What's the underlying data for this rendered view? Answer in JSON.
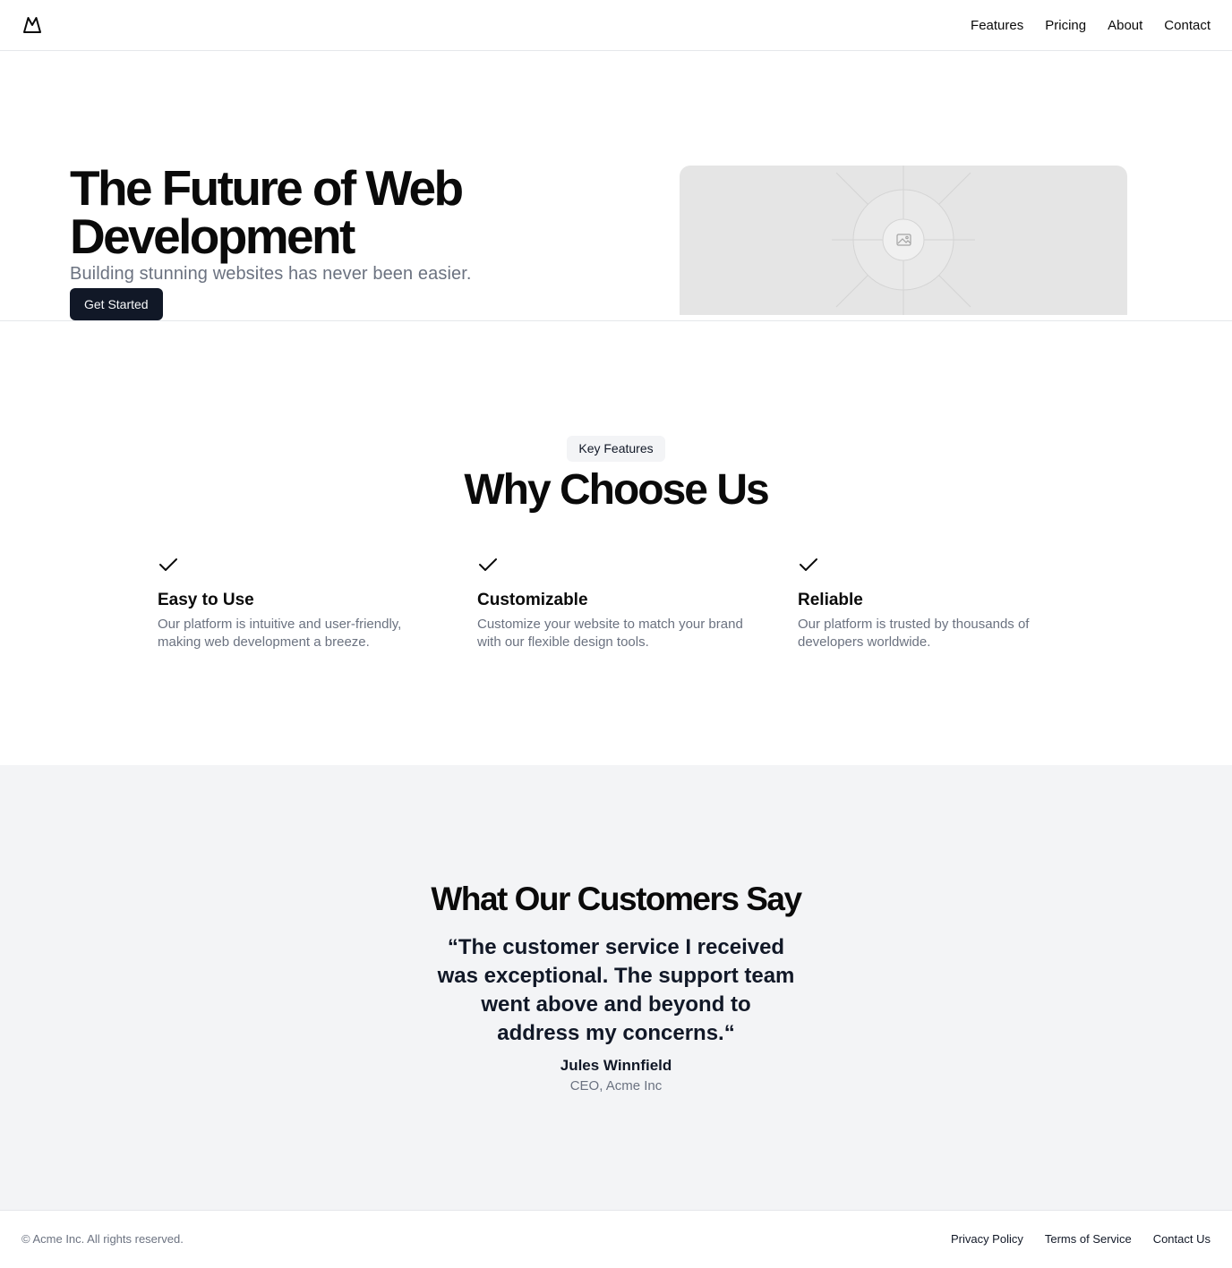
{
  "header": {
    "logo_icon": "mountain-icon",
    "nav": [
      {
        "label": "Features"
      },
      {
        "label": "Pricing"
      },
      {
        "label": "About"
      },
      {
        "label": "Contact"
      }
    ]
  },
  "hero": {
    "title": "The Future of Web Development",
    "subtitle": "Building stunning websites has never been easier.",
    "cta_label": "Get Started",
    "image_icon": "image-placeholder-icon"
  },
  "features": {
    "badge": "Key Features",
    "title": "Why Choose Us",
    "items": [
      {
        "icon": "check-icon",
        "title": "Easy to Use",
        "description": "Our platform is intuitive and user-friendly, making web development a breeze."
      },
      {
        "icon": "check-icon",
        "title": "Customizable",
        "description": "Customize your website to match your brand with our flexible design tools."
      },
      {
        "icon": "check-icon",
        "title": "Reliable",
        "description": "Our platform is trusted by thousands of developers worldwide."
      }
    ]
  },
  "testimonial": {
    "title": "What Our Customers Say",
    "quote": "“The customer service I received was exceptional. The support team went above and beyond to address my concerns.“",
    "author": "Jules Winnfield",
    "role": "CEO, Acme Inc"
  },
  "footer": {
    "copyright": "© Acme Inc. All rights reserved.",
    "links": [
      {
        "label": "Privacy Policy"
      },
      {
        "label": "Terms of Service"
      },
      {
        "label": "Contact Us"
      }
    ]
  },
  "colors": {
    "primary": "#111827",
    "muted_text": "#6b7280",
    "muted_bg": "#f3f4f6",
    "border": "#e5e7eb"
  }
}
